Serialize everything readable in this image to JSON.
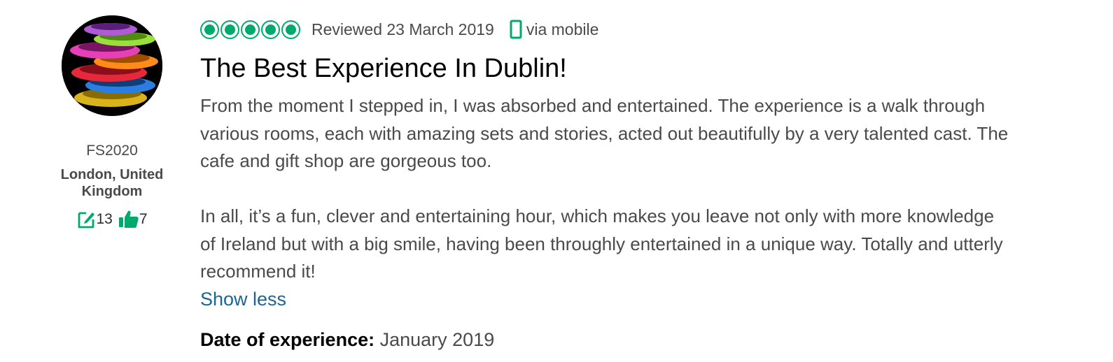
{
  "reviewer": {
    "username": "FS2020",
    "location": "London, United Kingdom",
    "contributions": "13",
    "helpful_votes": "7"
  },
  "review": {
    "rating": 5,
    "rating_max": 5,
    "reviewed_date": "Reviewed 23 March 2019",
    "device": "via mobile",
    "title": "The Best Experience In Dublin!",
    "paragraphs": [
      "From the moment I stepped in, I was absorbed and entertained. The experience is a walk through various rooms, each with amazing sets and stories, acted out beautifully by a very talented cast. The cafe and gift shop are gorgeous too.",
      "In all, it’s a fun, clever and entertaining hour, which makes you leave not only with more knowledge of Ireland but with a big smile, having been throughly entertained in a unique way. Totally and utterly recommend it!"
    ],
    "show_less_label": "Show less",
    "date_of_experience_label": "Date of experience:",
    "date_of_experience_value": "January 2019"
  },
  "icons": {
    "rating_bubble": "rating-bubble-icon",
    "mobile": "mobile-phone-icon",
    "contributions": "edit-note-icon",
    "helpful": "thumbs-up-icon"
  },
  "colors": {
    "accent_green": "#00aa6c",
    "link_blue": "#1d6496",
    "text": "#4a4a4a",
    "title": "#000000"
  }
}
